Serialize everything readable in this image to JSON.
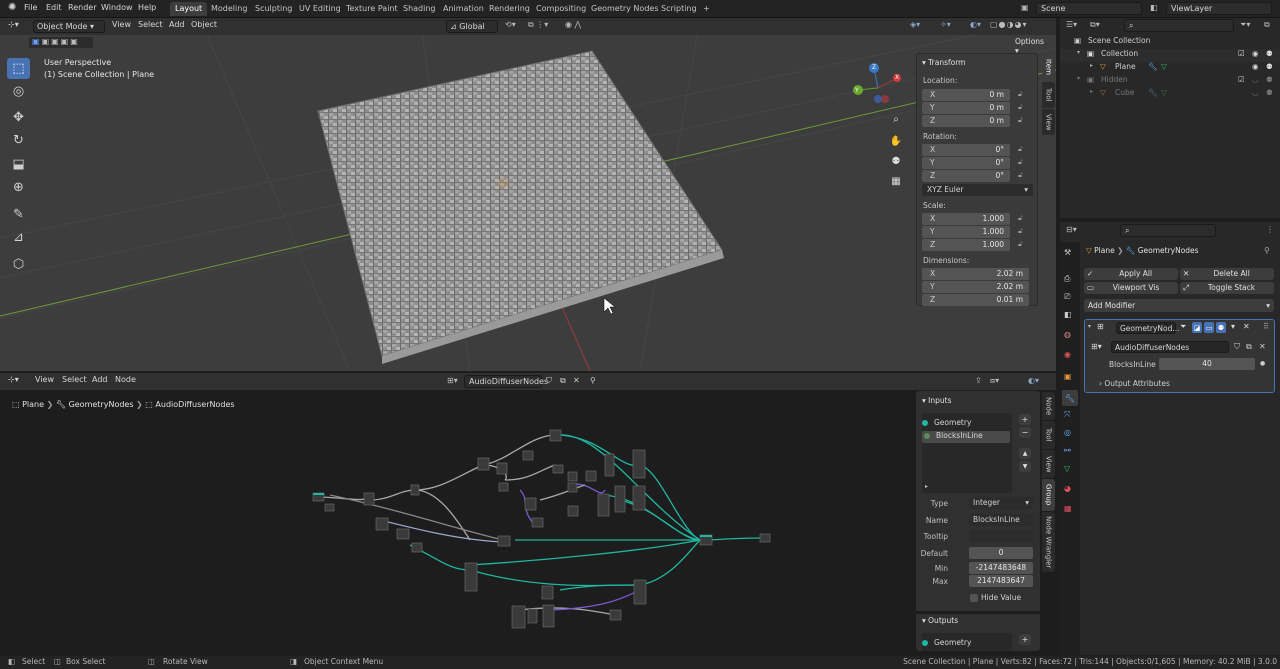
{
  "topbar": {
    "menus": [
      "File",
      "Edit",
      "Render",
      "Window",
      "Help"
    ],
    "workspaces": [
      "Layout",
      "Modeling",
      "Sculpting",
      "UV Editing",
      "Texture Paint",
      "Shading",
      "Animation",
      "Rendering",
      "Compositing",
      "Geometry Nodes",
      "Scripting"
    ],
    "add_tab": "+",
    "scene": "Scene",
    "view_layer": "ViewLayer"
  },
  "viewport": {
    "mode": "Object Mode",
    "menus": [
      "View",
      "Select",
      "Add",
      "Object"
    ],
    "orientation": "Global",
    "options": "Options",
    "perspective": "User Perspective",
    "collection_info": "(1) Scene Collection | Plane",
    "tools": [
      "select-icon",
      "cursor-icon",
      "move-icon",
      "rotate-icon",
      "scale-icon",
      "transform-icon",
      "annotate-icon",
      "measure-icon",
      "add-cube-icon"
    ],
    "gizmo": {
      "x": "X",
      "y": "Y",
      "z": "Z"
    },
    "side_tabs": [
      "Item",
      "Tool",
      "View"
    ]
  },
  "transform": {
    "title": "Transform",
    "location_label": "Location:",
    "rotation_label": "Rotation:",
    "scale_label": "Scale:",
    "dimensions_label": "Dimensions:",
    "rotation_mode": "XYZ Euler",
    "location": [
      {
        "axis": "X",
        "value": "0 m"
      },
      {
        "axis": "Y",
        "value": "0 m"
      },
      {
        "axis": "Z",
        "value": "0 m"
      }
    ],
    "rotation": [
      {
        "axis": "X",
        "value": "0°"
      },
      {
        "axis": "Y",
        "value": "0°"
      },
      {
        "axis": "Z",
        "value": "0°"
      }
    ],
    "scale": [
      {
        "axis": "X",
        "value": "1.000"
      },
      {
        "axis": "Y",
        "value": "1.000"
      },
      {
        "axis": "Z",
        "value": "1.000"
      }
    ],
    "dimensions": [
      {
        "axis": "X",
        "value": "2.02 m"
      },
      {
        "axis": "Y",
        "value": "2.02 m"
      },
      {
        "axis": "Z",
        "value": "0.01 m"
      }
    ]
  },
  "node_editor": {
    "menus": [
      "View",
      "Select",
      "Add",
      "Node"
    ],
    "node_group": "AudioDiffuserNodes",
    "breadcrumb": [
      "Plane",
      "GeometryNodes",
      "AudioDiffuserNodes"
    ],
    "side_tabs": [
      "Node",
      "Tool",
      "View",
      "Group",
      "Node Wrangler"
    ],
    "inputs_title": "Inputs",
    "inputs": [
      "Geometry",
      "BlocksInLine"
    ],
    "type_label": "Type",
    "type_value": "Integer",
    "name_label": "Name",
    "name_value": "BlocksInLine",
    "tooltip_label": "Tooltip",
    "tooltip_value": "",
    "default_label": "Default",
    "default_value": "0",
    "min_label": "Min",
    "min_value": "-2147483648",
    "max_label": "Max",
    "max_value": "2147483647",
    "hide_value": "Hide Value",
    "outputs_title": "Outputs",
    "outputs": [
      "Geometry"
    ]
  },
  "outliner": {
    "search_placeholder": "",
    "rows": [
      "Scene Collection",
      "Collection",
      "Plane",
      "Hidden",
      "Cube"
    ]
  },
  "properties": {
    "breadcrumb": [
      "Plane",
      "GeometryNodes"
    ],
    "apply_all": "Apply All",
    "delete_all": "Delete All",
    "viewport_vis": "Viewport Vis",
    "toggle_stack": "Toggle Stack",
    "add_modifier": "Add Modifier",
    "modifier_name": "GeometryNod...",
    "node_group": "AudioDiffuserNodes",
    "param_label": "BlocksInLine",
    "param_value": "40",
    "output_attributes": "Output Attributes"
  },
  "status": {
    "select": "Select",
    "box_select": "Box Select",
    "rotate_view": "Rotate View",
    "context_menu": "Object Context Menu",
    "stats": "Scene Collection | Plane | Verts:82 | Faces:72 | Tris:144 | Objects:0/1,605 | Memory: 40.2 MiB | 3.0.0"
  }
}
